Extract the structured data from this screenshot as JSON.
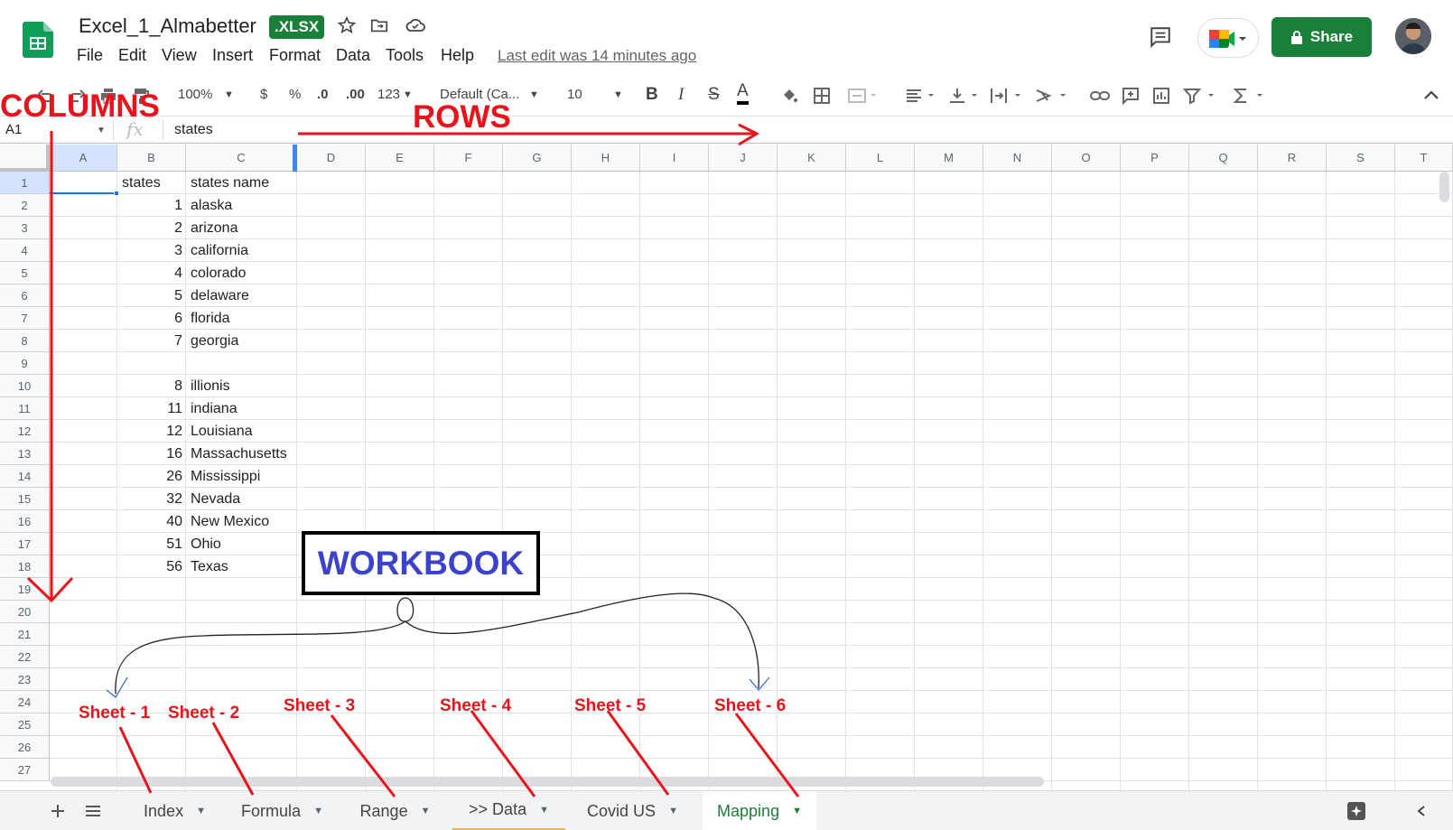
{
  "header": {
    "doc_title": "Excel_1_Almabetter",
    "badge": ".XLSX",
    "menu": [
      "File",
      "Edit",
      "View",
      "Insert",
      "Format",
      "Data",
      "Tools",
      "Help"
    ],
    "last_edit": "Last edit was 14 minutes ago",
    "share_label": "Share"
  },
  "toolbar": {
    "zoom": "100%",
    "currency": "$",
    "percent": "%",
    "dec_decrease": ".0",
    "dec_increase": ".00",
    "number_format": "123",
    "font": "Default (Ca...",
    "font_size": "10"
  },
  "formula_bar": {
    "name_box": "A1",
    "fx": "fx",
    "value": "states"
  },
  "columns": [
    "A",
    "B",
    "C",
    "D",
    "E",
    "F",
    "G",
    "H",
    "I",
    "J",
    "K",
    "L",
    "M",
    "N",
    "O",
    "P",
    "Q",
    "R",
    "S",
    "T"
  ],
  "rows": [
    "1",
    "2",
    "3",
    "4",
    "5",
    "6",
    "7",
    "8",
    "9",
    "10",
    "11",
    "12",
    "13",
    "14",
    "15",
    "16",
    "17",
    "18",
    "19",
    "20",
    "21",
    "22",
    "23",
    "24",
    "25",
    "26",
    "27"
  ],
  "cells": [
    {
      "row": 1,
      "b": "states",
      "c": "states name",
      "b_text": true
    },
    {
      "row": 2,
      "b": "1",
      "c": "alaska"
    },
    {
      "row": 3,
      "b": "2",
      "c": "arizona"
    },
    {
      "row": 4,
      "b": "3",
      "c": "california"
    },
    {
      "row": 5,
      "b": "4",
      "c": "colorado"
    },
    {
      "row": 6,
      "b": "5",
      "c": "delaware"
    },
    {
      "row": 7,
      "b": "6",
      "c": "florida"
    },
    {
      "row": 8,
      "b": "7",
      "c": "georgia"
    },
    {
      "row": 10,
      "b": "8",
      "c": "illionis"
    },
    {
      "row": 11,
      "b": "11",
      "c": "indiana"
    },
    {
      "row": 12,
      "b": "12",
      "c": "Louisiana"
    },
    {
      "row": 13,
      "b": "16",
      "c": "Massachusetts"
    },
    {
      "row": 14,
      "b": "26",
      "c": "Mississippi"
    },
    {
      "row": 15,
      "b": "32",
      "c": "Nevada"
    },
    {
      "row": 16,
      "b": "40",
      "c": "New Mexico"
    },
    {
      "row": 17,
      "b": "51",
      "c": "Ohio"
    },
    {
      "row": 18,
      "b": "56",
      "c": "Texas"
    }
  ],
  "tabs": [
    "Index",
    "Formula",
    "Range",
    ">> Data",
    "Covid US",
    "Mapping"
  ],
  "active_tab": "Mapping",
  "annotations": {
    "columns": "COLUMNS",
    "rows": "ROWS",
    "workbook": "WORKBOOK",
    "sheets": [
      "Sheet - 1",
      "Sheet - 2",
      "Sheet - 3",
      "Sheet - 4",
      "Sheet - 5",
      "Sheet - 6"
    ]
  },
  "colors": {
    "green": "#188038",
    "annotation_red": "#e8141c",
    "workbook_blue": "#3b42cc",
    "active_tab": "#188038"
  }
}
